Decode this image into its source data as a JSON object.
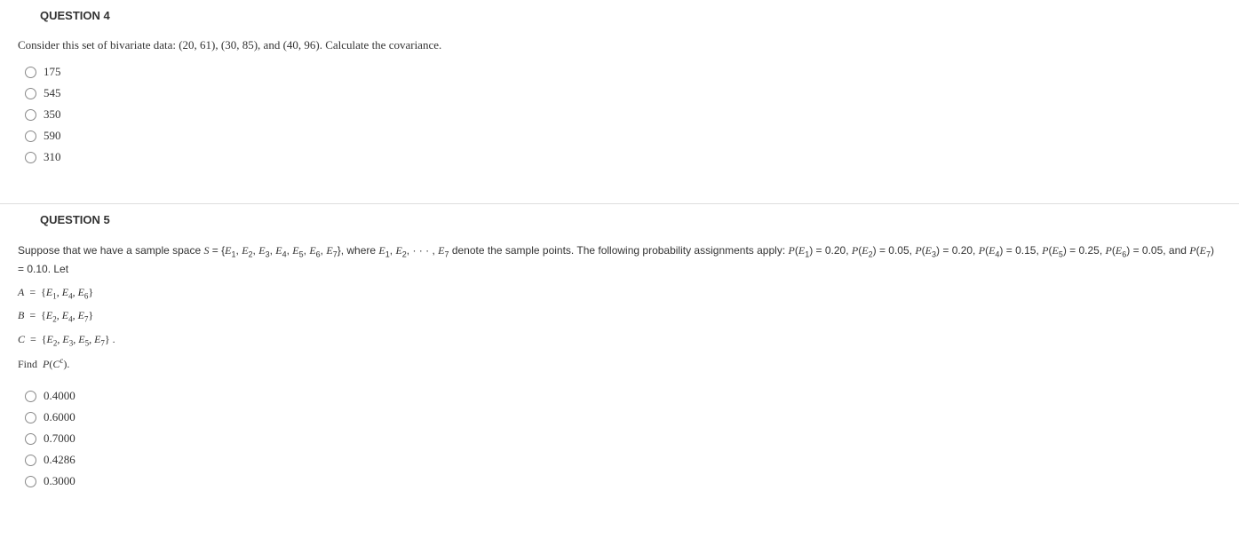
{
  "question4": {
    "header": "QUESTION 4",
    "text": "Consider this set of bivariate data: (20, 61), (30, 85), and (40, 96).  Calculate the covariance.",
    "options": [
      "175",
      "545",
      "350",
      "590",
      "310"
    ]
  },
  "question5": {
    "header": "QUESTION 5",
    "intro_part1": "Suppose that we have a sample space ",
    "sample_space": "S = {E₁, E₂, E₃, E₄, E₅, E₆, E₇}",
    "intro_part2": ", where ",
    "where_list": "E₁, E₂, · · · , E₇",
    "intro_part3": " denote the sample points. The following probability assignments apply: ",
    "probs": "P(E₁) = 0.20,  P(E₂) = 0.05,  P(E₃) = 0.20,  P(E₄) = 0.15, P(E₅) = 0.25,  P(E₆) = 0.05,  and P(E₇) = 0.10.  Let",
    "setA": "A  =  {E₁, E₄, E₆}",
    "setB": "B  =  {E₂, E₄, E₇}",
    "setC": "C  =  {E₂, E₃, E₅, E₇} .",
    "find": "Find  P(Cᶜ).",
    "options": [
      "0.4000",
      "0.6000",
      "0.7000",
      "0.4286",
      "0.3000"
    ]
  }
}
